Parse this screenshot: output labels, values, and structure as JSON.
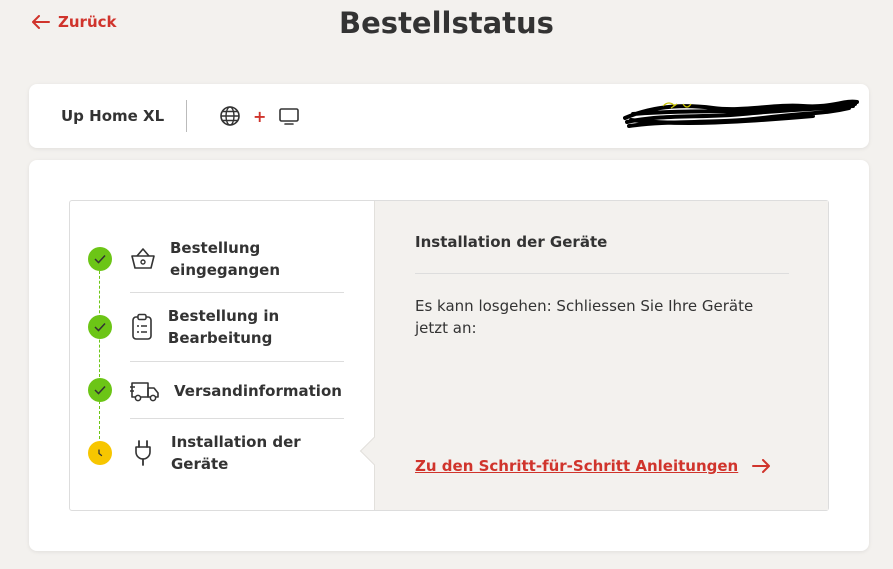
{
  "header": {
    "back_label": "Zurück",
    "title": "Bestellstatus"
  },
  "product": {
    "name": "Up Home XL",
    "plus": "+",
    "icons": [
      "globe-icon",
      "tv-icon"
    ],
    "redacted_note": "scribbled-out-customer-info"
  },
  "steps": [
    {
      "label": "Bestellung eingegangen",
      "icon": "basket-icon",
      "status": "done"
    },
    {
      "label": "Bestellung in Bearbeitung",
      "icon": "clipboard-icon",
      "status": "done"
    },
    {
      "label": "Versandinformation",
      "icon": "truck-icon",
      "status": "done"
    },
    {
      "label": "Installation der Geräte",
      "icon": "plug-icon",
      "status": "current"
    }
  ],
  "detail": {
    "title": "Installation der Geräte",
    "text": "Es kann losgehen: Schliessen Sie Ihre Geräte jetzt an:",
    "link_label": "Zu den Schritt-für-Schritt Anleitungen"
  },
  "colors": {
    "accent": "#d0342c",
    "done": "#6cc516",
    "current": "#f7c600",
    "background": "#f3f1ee"
  }
}
